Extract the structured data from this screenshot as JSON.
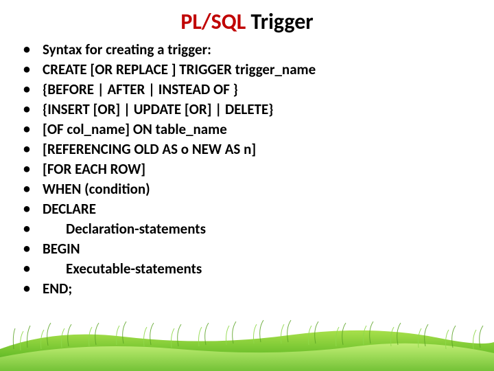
{
  "title": {
    "part1": "PL/SQL",
    "part2": " Trigger"
  },
  "bullets": [
    {
      "text": "Syntax for creating a trigger:",
      "indent": false
    },
    {
      "text": "CREATE [OR REPLACE ] TRIGGER trigger_name",
      "indent": false
    },
    {
      "text": "{BEFORE | AFTER | INSTEAD OF }",
      "indent": false
    },
    {
      "text": "{INSERT [OR] | UPDATE [OR] | DELETE}",
      "indent": false
    },
    {
      "text": "[OF col_name] ON table_name",
      "indent": false
    },
    {
      "text": "[REFERENCING OLD AS o NEW AS n]",
      "indent": false
    },
    {
      "text": "[FOR EACH ROW]",
      "indent": false
    },
    {
      "text": "WHEN (condition)",
      "indent": false
    },
    {
      "text": "DECLARE",
      "indent": false
    },
    {
      "text": "Declaration-statements",
      "indent": true
    },
    {
      "text": "BEGIN",
      "indent": false
    },
    {
      "text": "Executable-statements",
      "indent": true
    },
    {
      "text": "END;",
      "indent": false
    }
  ]
}
